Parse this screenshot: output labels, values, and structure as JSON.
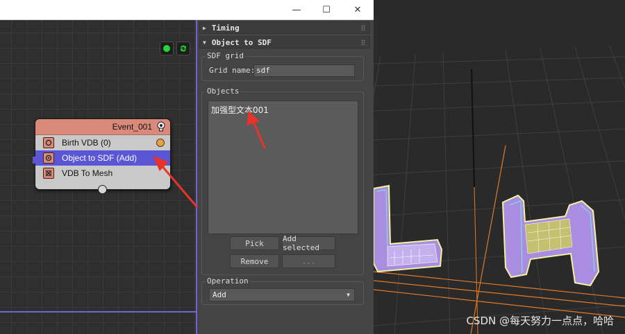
{
  "window": {
    "minimize_glyph": "—",
    "maximize_glyph": "☐",
    "close_glyph": "✕"
  },
  "node": {
    "title": "Event_001",
    "rows": [
      {
        "label": "Birth VDB (0)"
      },
      {
        "label": "Object to SDF (Add)"
      },
      {
        "label": "VDB To Mesh"
      }
    ]
  },
  "panel": {
    "timing_rollout": "Timing",
    "object_rollout": "Object to SDF",
    "sdf_group": "SDF grid",
    "grid_name_label": "Grid name:",
    "grid_name_value": "sdf",
    "objects_group": "Objects",
    "objects_list": [
      "加强型文本001"
    ],
    "pick_button": "Pick",
    "add_selected_button": "Add selected",
    "remove_button": "Remove",
    "more_button": "...",
    "operation_group": "Operation",
    "operation_value": "Add"
  },
  "watermark": "CSDN @每天努力一点点，哈哈",
  "colors": {
    "node_header": "#d98a7a",
    "selection": "#5b56d6",
    "annotation_arrow": "#e8322a",
    "viewport_accent": "#e07a2a"
  }
}
